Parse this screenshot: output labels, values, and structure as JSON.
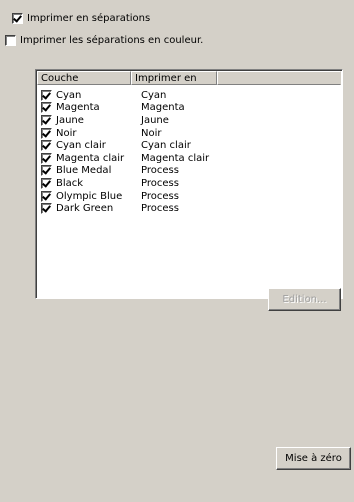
{
  "options": {
    "print_separations": {
      "label": "Imprimer en séparations",
      "checked": true
    },
    "print_color_separations": {
      "label": "Imprimer les séparations en couleur.",
      "checked": false
    }
  },
  "table": {
    "headers": [
      "Couche",
      "Imprimer en",
      ""
    ],
    "rows": [
      {
        "layer": "Cyan",
        "print_as": "Cyan",
        "checked": true
      },
      {
        "layer": "Magenta",
        "print_as": "Magenta",
        "checked": true
      },
      {
        "layer": "Jaune",
        "print_as": "Jaune",
        "checked": true
      },
      {
        "layer": "Noir",
        "print_as": "Noir",
        "checked": true
      },
      {
        "layer": "Cyan clair",
        "print_as": "Cyan clair",
        "checked": true
      },
      {
        "layer": "Magenta clair",
        "print_as": "Magenta clair",
        "checked": true
      },
      {
        "layer": "Blue Medal",
        "print_as": "Process",
        "checked": true
      },
      {
        "layer": "Black",
        "print_as": "Process",
        "checked": true
      },
      {
        "layer": "Olympic Blue",
        "print_as": "Process",
        "checked": true
      },
      {
        "layer": "Dark Green",
        "print_as": "Process",
        "checked": true
      }
    ]
  },
  "buttons": {
    "edit": {
      "label": "Edition...",
      "enabled": false
    },
    "reset": {
      "label": "Mise à zéro",
      "enabled": true
    }
  },
  "colors": {
    "face": "#d4d0c8",
    "disabled_text": "#a0a0a0"
  }
}
